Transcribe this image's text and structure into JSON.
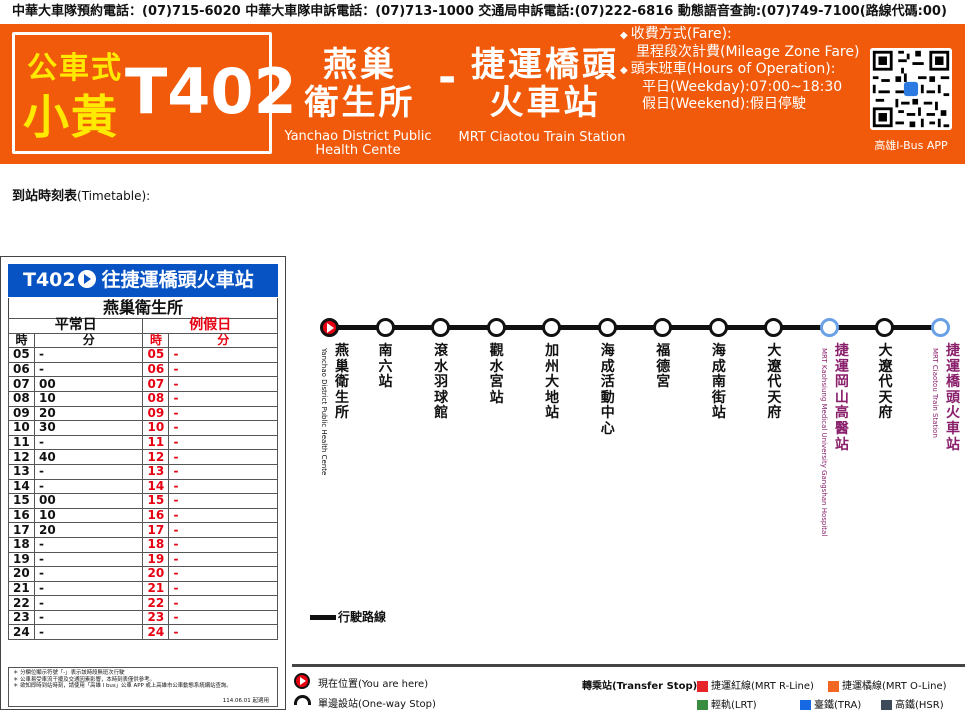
{
  "topbar": {
    "text": "中華大車隊預約電話：(07)715-6020  中華大車隊申訴電話：(07)713-1000  交通局申訴電話:(07)222-6816 動態語音查詢:(07)749-7100(路線代碼:00)"
  },
  "banner": {
    "type_label": "公車式",
    "brand_label": "小黃",
    "route_number": "T402",
    "from_zh_line1": "燕巢",
    "from_zh_line2": "衛生所",
    "from_en": "Yanchao District Public Health Cente",
    "dash": "-",
    "to_zh_line1": "捷運橋頭",
    "to_zh_line2": "火車站",
    "to_en": "MRT Ciaotou Train Station",
    "fare_title": "收費方式(Fare):",
    "fare_value": "里程段次計費(Mileage Zone Fare)",
    "hours_title": "頭末班車(Hours of Operation):",
    "weekday": "平日(Weekday):07:00~18:30",
    "weekend": "假日(Weekend):假日停駛",
    "qr_label": "高雄I-Bus APP",
    "bullet": "◆"
  },
  "timetable_label": {
    "zh": "到站時刻表",
    "en": "(Timetable):"
  },
  "panel": {
    "route": "T402",
    "direction": "往捷運橋頭火車站",
    "stop": "燕巢衛生所",
    "weekday_label": "平常日",
    "holiday_label": "例假日",
    "hour_label": "時",
    "minute_label": "分",
    "rows": [
      {
        "h": "05",
        "m": "-",
        "hh": "05",
        "hm": "-"
      },
      {
        "h": "06",
        "m": "-",
        "hh": "06",
        "hm": "-"
      },
      {
        "h": "07",
        "m": "00",
        "hh": "07",
        "hm": "-"
      },
      {
        "h": "08",
        "m": "10",
        "hh": "08",
        "hm": "-"
      },
      {
        "h": "09",
        "m": "20",
        "hh": "09",
        "hm": "-"
      },
      {
        "h": "10",
        "m": "30",
        "hh": "10",
        "hm": "-"
      },
      {
        "h": "11",
        "m": "-",
        "hh": "11",
        "hm": "-"
      },
      {
        "h": "12",
        "m": "40",
        "hh": "12",
        "hm": "-"
      },
      {
        "h": "13",
        "m": "-",
        "hh": "13",
        "hm": "-"
      },
      {
        "h": "14",
        "m": "-",
        "hh": "14",
        "hm": "-"
      },
      {
        "h": "15",
        "m": "00",
        "hh": "15",
        "hm": "-"
      },
      {
        "h": "16",
        "m": "10",
        "hh": "16",
        "hm": "-"
      },
      {
        "h": "17",
        "m": "20",
        "hh": "17",
        "hm": "-"
      },
      {
        "h": "18",
        "m": "-",
        "hh": "18",
        "hm": "-"
      },
      {
        "h": "19",
        "m": "-",
        "hh": "19",
        "hm": "-"
      },
      {
        "h": "20",
        "m": "-",
        "hh": "20",
        "hm": "-"
      },
      {
        "h": "21",
        "m": "-",
        "hh": "21",
        "hm": "-"
      },
      {
        "h": "22",
        "m": "-",
        "hh": "22",
        "hm": "-"
      },
      {
        "h": "23",
        "m": "-",
        "hh": "23",
        "hm": "-"
      },
      {
        "h": "24",
        "m": "-",
        "hh": "24",
        "hm": "-"
      }
    ],
    "notes": [
      "＊ 分欄位顯示符號「-」表示該時段無班次行駛",
      "＊ 公車易受車流干擾及交通因素影響，本時刻表僅供參考。",
      "＊ 欲知即時到站時刻，請使用「高雄 I bus」公車 APP 或上高雄市公車動態系統網站查詢。"
    ],
    "version": "114.06.01 起適用"
  },
  "stations": [
    {
      "zh": "燕巢衛生所",
      "en": "Yanchao District Public Health Cente",
      "type": "current"
    },
    {
      "zh": "南六站",
      "en": "",
      "type": "normal"
    },
    {
      "zh": "滾水羽球館",
      "en": "",
      "type": "normal"
    },
    {
      "zh": "觀水宮站",
      "en": "",
      "type": "normal"
    },
    {
      "zh": "加州大地站",
      "en": "",
      "type": "normal"
    },
    {
      "zh": "海成活動中心",
      "en": "",
      "type": "normal"
    },
    {
      "zh": "福德宮",
      "en": "",
      "type": "normal"
    },
    {
      "zh": "海成南街站",
      "en": "",
      "type": "normal"
    },
    {
      "zh": "大遼代天府",
      "en": "",
      "type": "normal"
    },
    {
      "zh": "捷運岡山高醫站",
      "en": "MRT Kaohsiung Medical University Gangshan Hospital",
      "type": "transfer"
    },
    {
      "zh": "大遼代天府",
      "en": "",
      "type": "normal"
    },
    {
      "zh": "捷運橋頭火車站",
      "en": "MRT Ciaotou Train Station",
      "type": "transfer"
    }
  ],
  "legend": {
    "route_line": "行駛路線"
  },
  "footer": {
    "you_are_here": "現在位置(You are here)",
    "one_way": "單邊設站(One-way Stop)",
    "transfer_label": "轉乘站(Transfer Stop):",
    "transfers": [
      {
        "label": "捷運紅線(MRT R-Line)",
        "color": "#e5252a"
      },
      {
        "label": "捷運橘線(MRT O-Line)",
        "color": "#f26722"
      },
      {
        "label": "輕軌(LRT)",
        "color": "#3a8d3f"
      },
      {
        "label": "臺鐵(TRA)",
        "color": "#1668e3"
      },
      {
        "label": "高鐵(HSR)",
        "color": "#3d4a5a"
      }
    ]
  },
  "colors": {
    "banner": "#f05a0a",
    "accent_yellow": "#ffe900",
    "panel_head": "#0753c4",
    "holiday_red": "#e60012"
  }
}
